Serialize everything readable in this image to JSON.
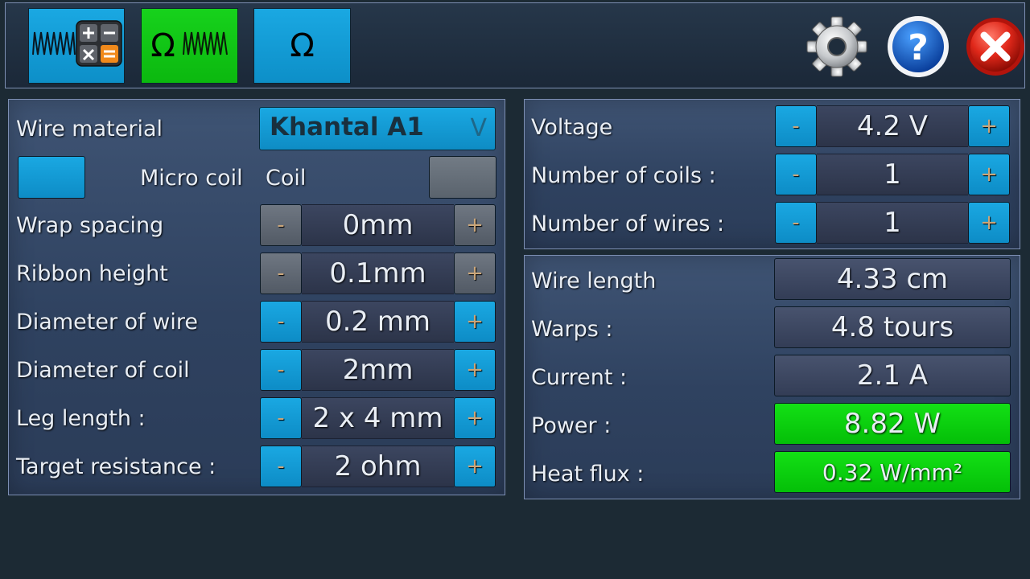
{
  "toolbar": {
    "buttons": [
      {
        "name": "coil-calculator",
        "icon": "coil-calculator-icon",
        "active": false
      },
      {
        "name": "ohm-coil",
        "icon": "ohm-coil-icon",
        "symbol": "Ω",
        "active": true
      },
      {
        "name": "ohm",
        "icon": "ohm-icon",
        "symbol": "Ω",
        "active": false
      }
    ],
    "settings_icon": "gear-icon",
    "help_icon": "question-mark-icon",
    "close_icon": "close-icon"
  },
  "left_panel": {
    "wire_material": {
      "label": "Wire material",
      "value": "Khantal A1",
      "arrow": "V"
    },
    "coil_type": {
      "micro_label": "Micro coil",
      "coil_label": "Coil"
    },
    "rows": [
      {
        "label": "Wrap spacing",
        "value": "0mm",
        "enabled": false
      },
      {
        "label": "Ribbon height",
        "value": "0.1mm",
        "enabled": false
      },
      {
        "label": "Diameter of wire",
        "value": "0.2 mm",
        "enabled": true
      },
      {
        "label": "Diameter of coil",
        "value": "2mm",
        "enabled": true
      },
      {
        "label": "Leg length :",
        "value": "2 x 4 mm",
        "enabled": true
      },
      {
        "label": "Target resistance :",
        "value": "2 ohm",
        "enabled": true
      }
    ],
    "minus": "-",
    "plus": "+"
  },
  "right_top_panel": {
    "rows": [
      {
        "label": "Voltage",
        "value": "4.2 V"
      },
      {
        "label": "Number of coils :",
        "value": "1"
      },
      {
        "label": "Number of wires :",
        "value": "1"
      }
    ],
    "minus": "-",
    "plus": "+"
  },
  "results_panel": {
    "rows": [
      {
        "label": "Wire length",
        "value": "4.33 cm",
        "highlight": false
      },
      {
        "label": "Warps :",
        "value": "4.8 tours",
        "highlight": false
      },
      {
        "label": "Current :",
        "value": "2.1 A",
        "highlight": false
      },
      {
        "label": "Power :",
        "value": "8.82 W",
        "highlight": true
      },
      {
        "label": "Heat flux :",
        "value": "0.32 W/mm²",
        "highlight": true
      }
    ]
  },
  "colors": {
    "accent_blue": "#1aa8e2",
    "active_green": "#13e015",
    "background": "#1c2a34"
  }
}
